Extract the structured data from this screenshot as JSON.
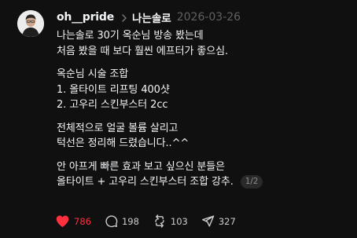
{
  "post": {
    "username": "oh__pride",
    "community": "나는솔로",
    "date": "2026-03-26",
    "body": {
      "p1": [
        "나는솔로 30기 옥순님 방송 봤는데",
        "처음 봤을 때 보다 훨씬 에프터가 좋으심."
      ],
      "p2": [
        "옥순님 시술 조합",
        "1. 올타이트 리프팅 400샷",
        "2. 고우리 스킨부스터 2cc"
      ],
      "p3": [
        "전체적으로 얼굴 볼륨 살리고",
        "턱선은 정리해 드렸습니다..^^"
      ],
      "p4": [
        "안 아프게 빠른 효과 보고 싶으신 분들은",
        "올타이트 + 고우리 스킨부스터 조합 강추."
      ]
    },
    "page_indicator": "1/2"
  },
  "actions": {
    "likes": "786",
    "comments": "198",
    "reposts": "103",
    "shares": "327"
  },
  "icons": {
    "like": "heart-icon",
    "comment": "comment-bubble-icon",
    "repost": "repost-icon",
    "share": "send-icon",
    "separator": "chevron-right-icon"
  },
  "colors": {
    "background": "#101010",
    "text": "#f3f5f7",
    "muted": "#616161",
    "liked": "#ff3040"
  }
}
